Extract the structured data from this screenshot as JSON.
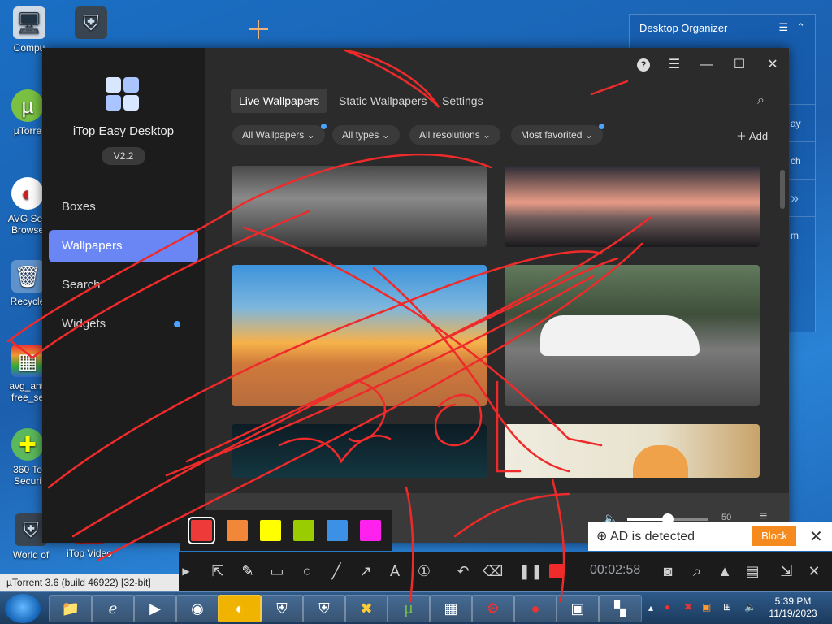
{
  "desktop": {
    "icons": [
      {
        "label": "Compu",
        "icon": "computer-icon"
      },
      {
        "label": "µTorre",
        "icon": "utorrent-icon"
      },
      {
        "label": "AVG Sec Browse",
        "icon": "avg-browser-icon"
      },
      {
        "label": "Recycle",
        "icon": "recycle-bin-icon"
      },
      {
        "label": "avg_anti free_se",
        "icon": "avg-installer-icon"
      },
      {
        "label": "360 To Securi",
        "icon": "360-security-icon"
      },
      {
        "label": "World of",
        "icon": "world-of-tanks-icon"
      },
      {
        "label": "iTop Video",
        "icon": "itop-video-icon"
      }
    ]
  },
  "organizer": {
    "title": "Desktop Organizer",
    "side_fragments": [
      "ay",
      "ch",
      "»",
      "m"
    ]
  },
  "app": {
    "name": "iTop Easy Desktop",
    "version": "V2.2",
    "nav": [
      "Boxes",
      "Wallpapers",
      "Search",
      "Widgets"
    ],
    "active_nav": "Wallpapers",
    "tabs": [
      "Live Wallpapers",
      "Static Wallpapers",
      "Settings"
    ],
    "active_tab": "Live Wallpapers",
    "filters": [
      "All Wallpapers",
      "All types",
      "All resolutions",
      "Most favorited"
    ],
    "add_label": "Add",
    "volume": 50,
    "thumbnails": [
      {
        "name": "rain-on-glass",
        "colors": [
          "#555",
          "#888",
          "#3a3a3a"
        ]
      },
      {
        "name": "birds-at-sunset",
        "colors": [
          "#2a2a35",
          "#d88a7a",
          "#1a1a1e"
        ]
      },
      {
        "name": "desert-sunset",
        "colors": [
          "#3a8fd6",
          "#f3a23a",
          "#c56a3a"
        ]
      },
      {
        "name": "white-sports-car",
        "colors": [
          "#4a5a45",
          "#6e6e6e",
          "#3a3a3a"
        ]
      },
      {
        "name": "starry-water",
        "colors": [
          "#0c1a22",
          "#12323b",
          "#0a1418"
        ]
      },
      {
        "name": "kitten",
        "colors": [
          "#e5e0cf",
          "#d9c7a3",
          "#b89a6a"
        ]
      }
    ]
  },
  "recorder": {
    "colors": [
      "#ef3a3a",
      "#f2873a",
      "#ffff00",
      "#9acd00",
      "#3c91e6",
      "#ff22ee"
    ],
    "selected_color": 0,
    "time": "00:02:58"
  },
  "ad": {
    "text": "AD is detected",
    "block_label": "Block"
  },
  "utorrent_strip": "µTorrent 3.6  (build 46922) [32-bit]",
  "taskbar": {
    "apps": [
      "explorer-icon",
      "ie-icon",
      "media-player-icon",
      "chrome-icon",
      "avg-browser-icon",
      "world-of-tanks-icon",
      "world-of-warships-icon",
      "game-icon",
      "utorrent-icon",
      "control-panel-icon",
      "app-icon",
      "itop-screen-recorder-icon",
      "monitor-icon",
      "itop-easy-desktop-icon"
    ],
    "time": "5:39 PM",
    "date": "11/19/2023"
  }
}
